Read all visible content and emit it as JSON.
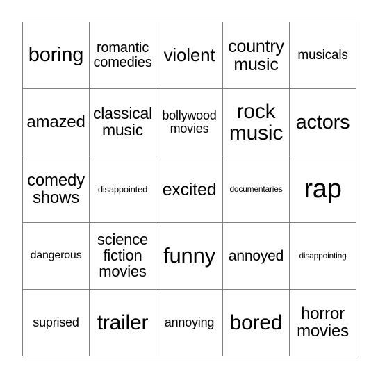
{
  "card": {
    "type": "bingo-card",
    "rows": 5,
    "columns": 5,
    "border_color": "#808080",
    "text_color": "#000000",
    "background_color": "#ffffff",
    "cells": [
      {
        "text": "boring",
        "font_size": 29,
        "lines": 1
      },
      {
        "text": "romantic\ncomedies",
        "font_size": 20,
        "lines": 2
      },
      {
        "text": "violent",
        "font_size": 26,
        "lines": 1
      },
      {
        "text": "country\nmusic",
        "font_size": 25,
        "lines": 2
      },
      {
        "text": "musicals",
        "font_size": 19,
        "lines": 1
      },
      {
        "text": "amazed",
        "font_size": 24,
        "lines": 1
      },
      {
        "text": "classical\nmusic",
        "font_size": 23,
        "lines": 2
      },
      {
        "text": "bollywood\nmovies",
        "font_size": 18,
        "lines": 2
      },
      {
        "text": "rock\nmusic",
        "font_size": 30,
        "lines": 2
      },
      {
        "text": "actors",
        "font_size": 29,
        "lines": 1
      },
      {
        "text": "comedy\nshows",
        "font_size": 24,
        "lines": 2
      },
      {
        "text": "disappointed",
        "font_size": 13,
        "lines": 1
      },
      {
        "text": "excited",
        "font_size": 25,
        "lines": 1
      },
      {
        "text": "documentaries",
        "font_size": 12,
        "lines": 1
      },
      {
        "text": "rap",
        "font_size": 38,
        "lines": 1
      },
      {
        "text": "dangerous",
        "font_size": 16,
        "lines": 1
      },
      {
        "text": "science\nfiction\nmovies",
        "font_size": 22,
        "lines": 3
      },
      {
        "text": "funny",
        "font_size": 31,
        "lines": 1
      },
      {
        "text": "annoyed",
        "font_size": 21,
        "lines": 1
      },
      {
        "text": "disappointing",
        "font_size": 12,
        "lines": 1
      },
      {
        "text": "suprised",
        "font_size": 18,
        "lines": 1
      },
      {
        "text": "trailer",
        "font_size": 30,
        "lines": 1
      },
      {
        "text": "annoying",
        "font_size": 18,
        "lines": 1
      },
      {
        "text": "bored",
        "font_size": 30,
        "lines": 1
      },
      {
        "text": "horror\nmovies",
        "font_size": 24,
        "lines": 2
      }
    ]
  }
}
